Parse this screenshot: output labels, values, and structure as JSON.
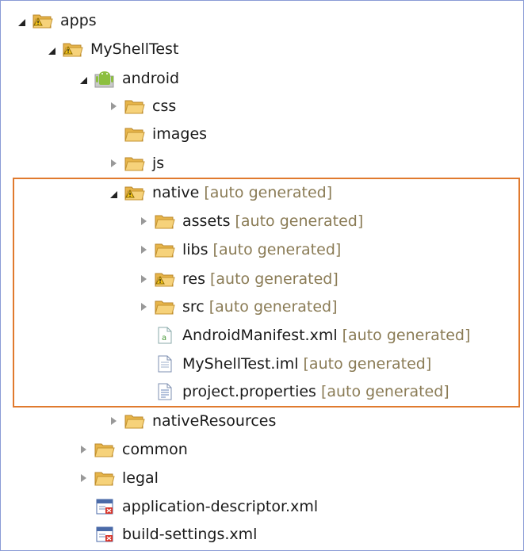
{
  "tree": {
    "decoration_text": "[auto generated]",
    "items": [
      {
        "label": "apps",
        "icon": "warning-folder-icon",
        "twisty": "expanded"
      },
      {
        "label": "MyShellTest",
        "icon": "warning-folder-icon",
        "twisty": "expanded"
      },
      {
        "label": "android",
        "icon": "android-folder-icon",
        "twisty": "expanded"
      },
      {
        "label": "css",
        "icon": "folder-icon",
        "twisty": "collapsed"
      },
      {
        "label": "images",
        "icon": "folder-icon",
        "twisty": "none"
      },
      {
        "label": "js",
        "icon": "folder-icon",
        "twisty": "collapsed"
      },
      {
        "label": "native",
        "icon": "warning-folder-icon",
        "twisty": "expanded",
        "decoration": "[auto generated]"
      },
      {
        "label": "assets",
        "icon": "folder-icon",
        "twisty": "collapsed",
        "decoration": "[auto generated]"
      },
      {
        "label": "libs",
        "icon": "folder-icon",
        "twisty": "collapsed",
        "decoration": "[auto generated]"
      },
      {
        "label": "res",
        "icon": "warning-folder-icon",
        "twisty": "collapsed",
        "decoration": "[auto generated]"
      },
      {
        "label": "src",
        "icon": "folder-icon",
        "twisty": "collapsed",
        "decoration": "[auto generated]"
      },
      {
        "label": "AndroidManifest.xml",
        "icon": "android-manifest-file-icon",
        "twisty": "none",
        "decoration": "[auto generated]"
      },
      {
        "label": "MyShellTest.iml",
        "icon": "text-file-icon",
        "twisty": "none",
        "decoration": "[auto generated]"
      },
      {
        "label": "project.properties",
        "icon": "properties-file-icon",
        "twisty": "none",
        "decoration": "[auto generated]"
      },
      {
        "label": "nativeResources",
        "icon": "folder-icon",
        "twisty": "collapsed"
      },
      {
        "label": "common",
        "icon": "folder-icon",
        "twisty": "collapsed"
      },
      {
        "label": "legal",
        "icon": "folder-icon",
        "twisty": "collapsed"
      },
      {
        "label": "application-descriptor.xml",
        "icon": "xml-file-icon",
        "twisty": "none"
      },
      {
        "label": "build-settings.xml",
        "icon": "xml-file-icon",
        "twisty": "none"
      }
    ]
  },
  "colors": {
    "frame_border": "#8a9bd6",
    "highlight_border": "#e07a2e",
    "decoration_text": "#8a7b55",
    "folder": "#f3c86a"
  }
}
